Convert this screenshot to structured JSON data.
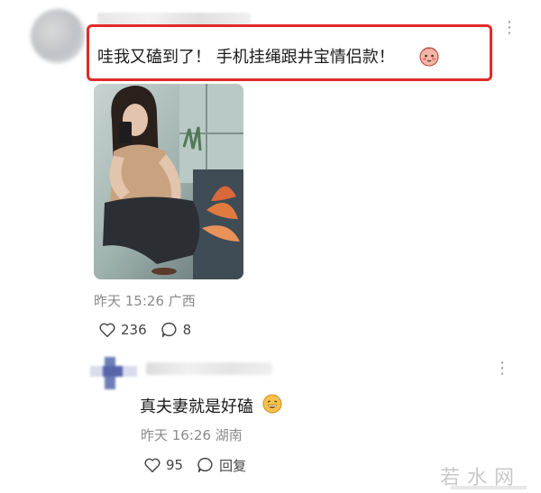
{
  "comment": {
    "text": "哇我又磕到了！ 手机挂绳跟井宝情侣款！",
    "emoji_icon": "blushing-emoji-icon",
    "photo_watermark": "",
    "timestamp": "昨天 15:26 广西",
    "likes": "236",
    "replies": "8"
  },
  "reply": {
    "text": "真夫妻就是好磕",
    "emoji_icon": "grinning-sweat-emoji-icon",
    "timestamp": "昨天 16:26 湖南",
    "likes": "95",
    "reply_label": "回复"
  },
  "more_label": "⋮",
  "watermark": "若水网",
  "colors": {
    "highlight": "#e02a2a",
    "meta_text": "#8a8a8a"
  }
}
